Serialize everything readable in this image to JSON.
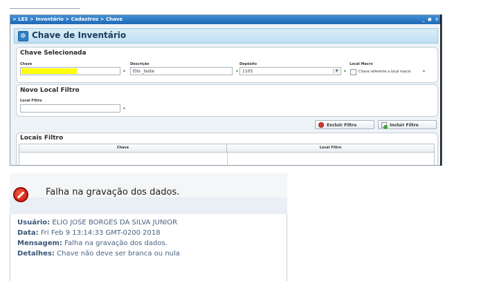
{
  "window": {
    "breadcrumb": "> LES > Inventário > Cadastros > Chave",
    "controls": "_ ◼ ×",
    "page_title": "Chave de Inventário"
  },
  "chave_selecionada": {
    "title": "Chave Selecionada",
    "chave_label": "Chave",
    "chave_value": "",
    "descricao_label": "Descrição",
    "descricao_value": "Elio _teste",
    "deposito_label": "Depósito",
    "deposito_value": "1105",
    "local_macro_label": "Local Macro",
    "local_macro_checkbox_label": "Chave referente a local macro",
    "local_macro_checked": false
  },
  "novo_local_filtro": {
    "title": "Novo Local Filtro",
    "local_filtro_label": "Local Filtro",
    "local_filtro_value": ""
  },
  "actions": {
    "excluir_label": "Excluir Filtro",
    "incluir_label": "Incluir Filtro"
  },
  "locais_filtro": {
    "title": "Locais Filtro",
    "columns": [
      "Chave",
      "Local Filtro"
    ],
    "rows": []
  },
  "error": {
    "title": "Falha na gravação dos dados.",
    "usuario_label": "Usuário:",
    "usuario_value": "ELIO JOSE BORGES DA SILVA JUNIOR",
    "data_label": "Data:",
    "data_value": "Fri Feb 9 13:14:33 GMT-0200 2018",
    "mensagem_label": "Mensagem:",
    "mensagem_value": "Falha na gravação dos dados.",
    "detalhes_label": "Detalhes:",
    "detalhes_value": "Chave não deve ser branca ou nula"
  },
  "colors": {
    "titlebar": "#1f68b4",
    "required_dot": "#3a9a2a",
    "highlight": "#ffff00",
    "error_icon": "#c4160a"
  }
}
